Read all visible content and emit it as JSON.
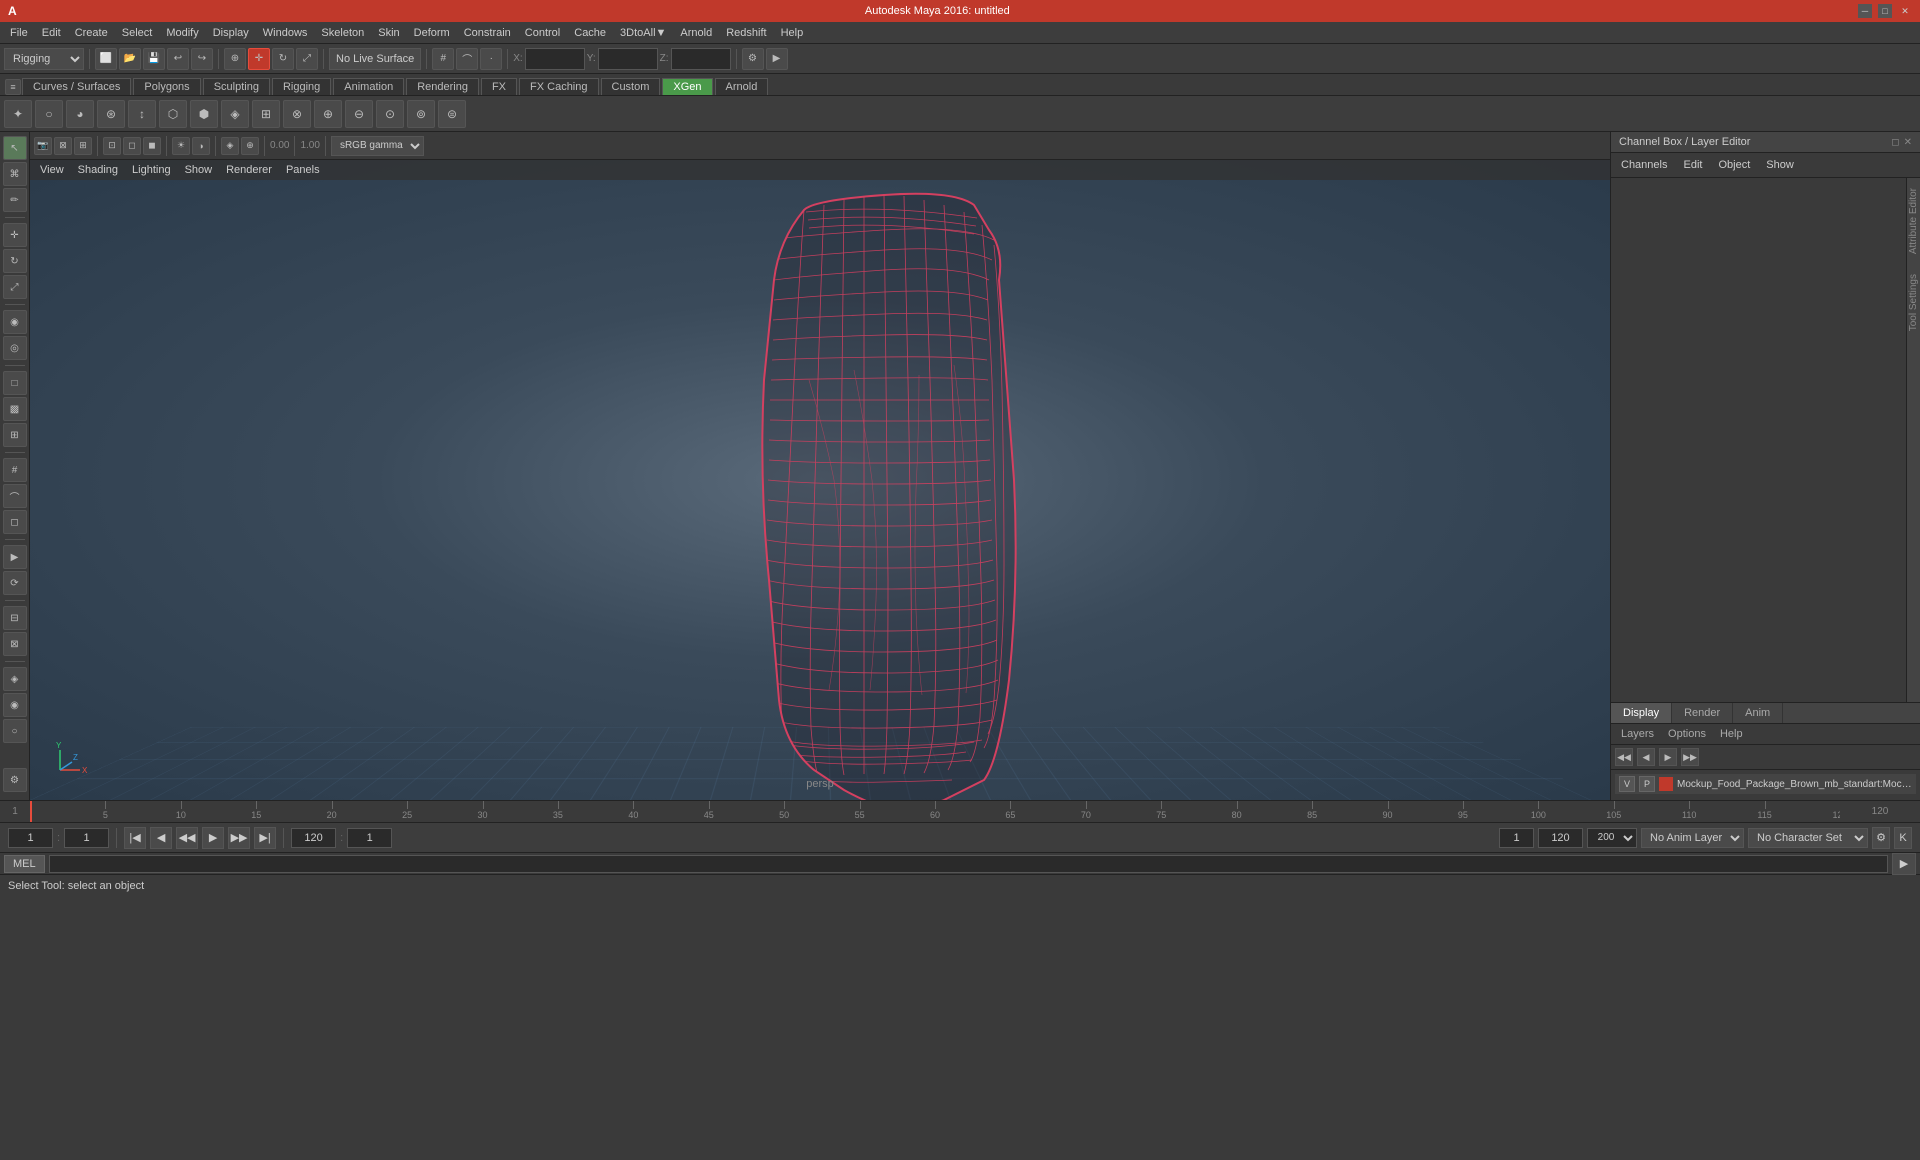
{
  "app": {
    "title": "Autodesk Maya 2016: untitled"
  },
  "title_bar": {
    "title": "Autodesk Maya 2016: untitled",
    "minimize": "─",
    "maximize": "□",
    "close": "✕"
  },
  "menu_bar": {
    "items": [
      "File",
      "Edit",
      "Create",
      "Select",
      "Modify",
      "Display",
      "Windows",
      "Skeleton",
      "Skin",
      "Deform",
      "Constrain",
      "Control",
      "Cache",
      "3DtoAll▼",
      "Arnold",
      "Redshift",
      "Help"
    ]
  },
  "toolbar1": {
    "mode_dropdown": "Rigging",
    "no_live_surface": "No Live Surface",
    "x_label": "X:",
    "y_label": "Y:",
    "z_label": "Z:",
    "x_val": "",
    "y_val": "",
    "z_val": ""
  },
  "shelf": {
    "tabs": [
      "Curves / Surfaces",
      "Polygons",
      "Sculpting",
      "Rigging",
      "Animation",
      "Rendering",
      "FX",
      "FX Caching",
      "Custom",
      "XGen",
      "Arnold"
    ],
    "active_tab": "XGen"
  },
  "viewport": {
    "menus": [
      "View",
      "Shading",
      "Lighting",
      "Show",
      "Renderer",
      "Panels"
    ],
    "label": "persp",
    "gamma": "sRGB gamma"
  },
  "channel_box": {
    "title": "Channel Box / Layer Editor",
    "close_btn": "✕",
    "float_btn": "◻",
    "tabs": {
      "channels_label": "Channels",
      "edit_label": "Edit",
      "object_label": "Object",
      "show_label": "Show"
    }
  },
  "layer_editor": {
    "tabs": [
      "Display",
      "Render",
      "Anim"
    ],
    "active_tab": "Display",
    "menus": [
      "Layers",
      "Options",
      "Help"
    ],
    "layer_item": {
      "vis": "V",
      "p": "P",
      "color": "#c0392b",
      "name": "Mockup_Food_Package_Brown_mb_standart:Mockup_Fc"
    }
  },
  "timeline": {
    "start": 1,
    "end": 120,
    "current": 1,
    "ticks": [
      0,
      50,
      100,
      150,
      200,
      250,
      300,
      350,
      400,
      450,
      500,
      550,
      600,
      650,
      700,
      750,
      800,
      850,
      900,
      950,
      1000,
      1050
    ],
    "tick_labels": [
      "",
      "5",
      "10",
      "15",
      "20",
      "25",
      "30",
      "35",
      "40",
      "45",
      "50",
      "55",
      "60",
      "65",
      "70",
      "75",
      "80",
      "85",
      "90",
      "95",
      "100",
      ""
    ]
  },
  "playback": {
    "current_frame": "1",
    "start_frame": "1",
    "end_frame": "120",
    "range_start": "1",
    "range_end": "120",
    "playback_end": "200",
    "anim_layer": "No Anim Layer",
    "char_set": "No Character Set"
  },
  "status_bar": {
    "mel_label": "MEL",
    "mel_placeholder": "",
    "status_message": "Select Tool: select an object"
  }
}
